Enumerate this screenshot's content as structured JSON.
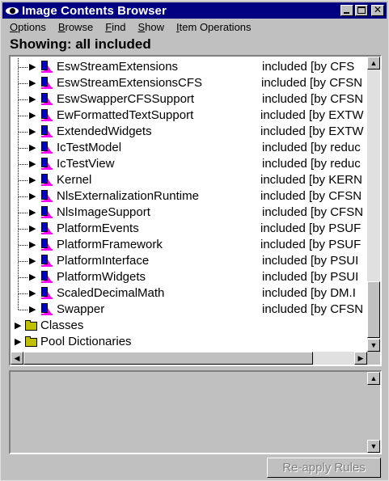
{
  "window": {
    "title": "Image Contents Browser"
  },
  "menu": [
    {
      "label": "Options",
      "u": "O"
    },
    {
      "label": "Browse",
      "u": "B"
    },
    {
      "label": "Find",
      "u": "F"
    },
    {
      "label": "Show",
      "u": "S"
    },
    {
      "label": "Item Operations",
      "u": "I"
    }
  ],
  "showing_label": "Showing: all included",
  "tree": {
    "items": [
      {
        "name": "EswStreamExtensions",
        "status": "included [by CFS"
      },
      {
        "name": "EswStreamExtensionsCFS",
        "status": "included [by CFSN"
      },
      {
        "name": "EswSwapperCFSSupport",
        "status": "included [by CFSN"
      },
      {
        "name": "EwFormattedTextSupport",
        "status": "included [by EXTW"
      },
      {
        "name": "ExtendedWidgets",
        "status": "included [by EXTW"
      },
      {
        "name": "IcTestModel",
        "status": "included [by reduc"
      },
      {
        "name": "IcTestView",
        "status": "included [by reduc"
      },
      {
        "name": "Kernel",
        "status": "included [by KERN"
      },
      {
        "name": "NlsExternalizationRuntime",
        "status": "included [by CFSN"
      },
      {
        "name": "NlsImageSupport",
        "status": "included [by CFSN"
      },
      {
        "name": "PlatformEvents",
        "status": "included [by PSUF"
      },
      {
        "name": "PlatformFramework",
        "status": "included [by PSUF"
      },
      {
        "name": "PlatformInterface",
        "status": "included [by PSUI"
      },
      {
        "name": "PlatformWidgets",
        "status": "included [by PSUI"
      },
      {
        "name": "ScaledDecimalMath",
        "status": "included [by DM.I"
      },
      {
        "name": "Swapper",
        "status": "included [by CFSN"
      }
    ],
    "categories": [
      {
        "name": "Classes"
      },
      {
        "name": "Pool Dictionaries"
      }
    ]
  },
  "buttons": {
    "reapply": "Re-apply Rules"
  },
  "icons": {
    "app": "eye-icon",
    "minimize": "minimize-icon",
    "maximize": "maximize-icon",
    "close": "close-icon",
    "class": "class-icon",
    "folder": "folder-icon"
  }
}
